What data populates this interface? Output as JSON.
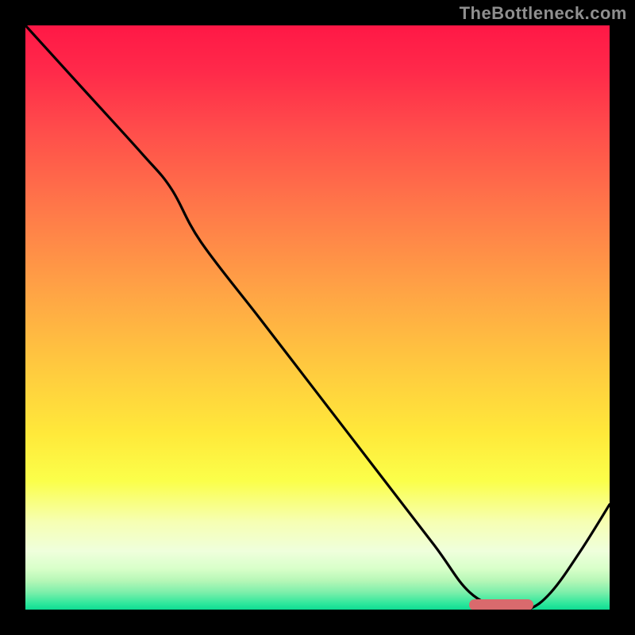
{
  "site": {
    "watermark": "TheBottleneck.com"
  },
  "colors": {
    "background": "#000000",
    "curve": "#000000",
    "marker": "#d96a6d",
    "watermark_text": "#8f8f8f"
  },
  "chart_data": {
    "type": "line",
    "title": "",
    "xlabel": "",
    "ylabel": "",
    "xlim": [
      0,
      100
    ],
    "ylim": [
      0,
      100
    ],
    "grid": false,
    "legend": false,
    "background": "gradient red→yellow→green (top→bottom)",
    "series": [
      {
        "name": "bottleneck-curve",
        "x": [
          0,
          10,
          20,
          25,
          30,
          40,
          50,
          60,
          70,
          76,
          82,
          86,
          90,
          95,
          100
        ],
        "values": [
          100,
          89,
          78,
          72,
          63,
          50,
          37,
          24,
          11,
          3,
          0,
          0,
          3,
          10,
          18
        ]
      }
    ],
    "annotations": [
      {
        "name": "optimal-range-marker",
        "x_start": 76,
        "x_end": 87,
        "y": 0.8
      }
    ]
  }
}
